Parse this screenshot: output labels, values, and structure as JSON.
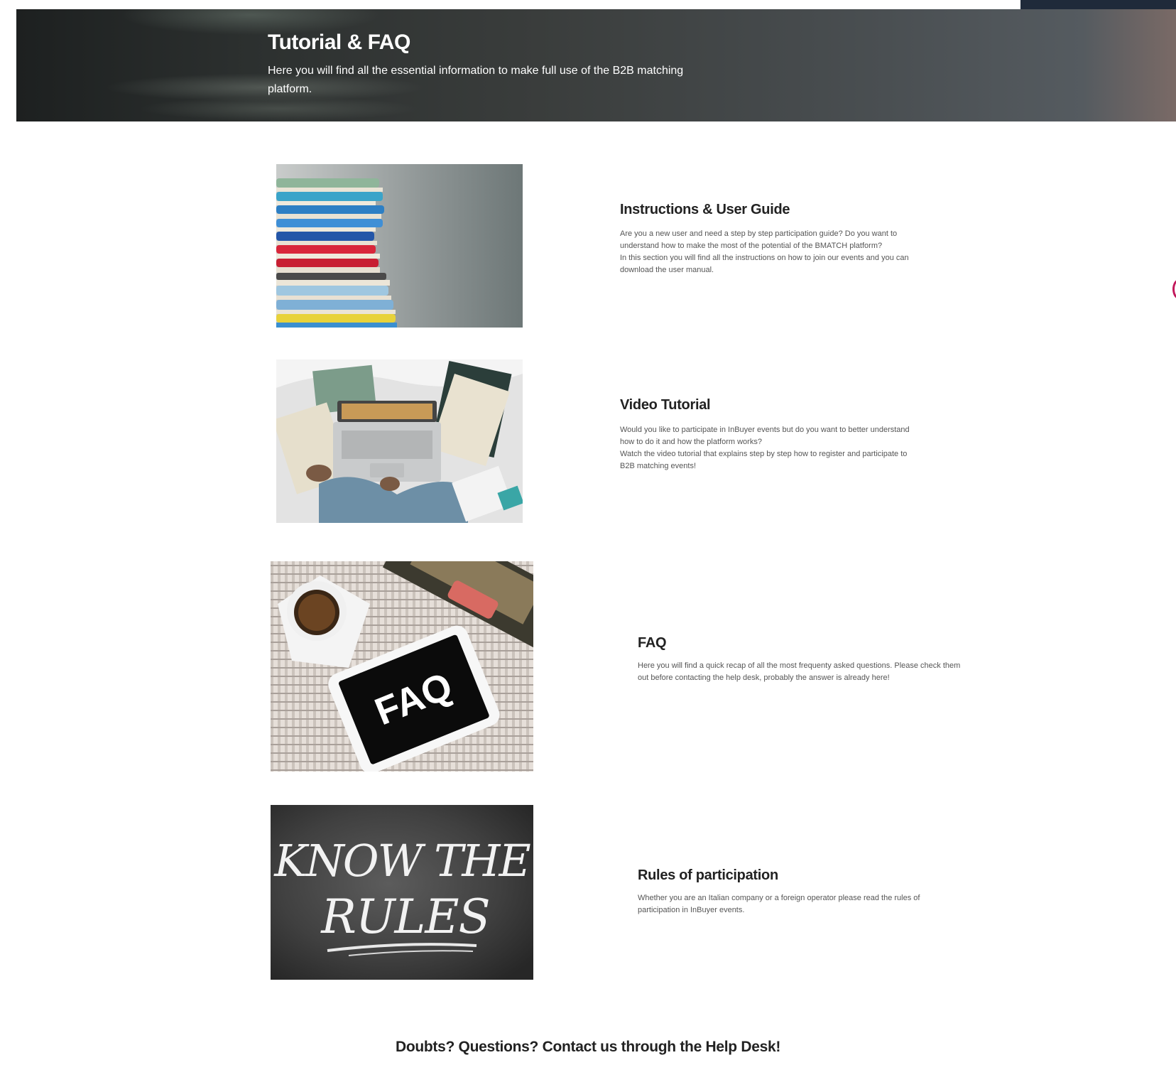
{
  "hero": {
    "title": "Tutorial & FAQ",
    "subtitle": "Here you will find all the essential information to make full use of the B2B matching platform."
  },
  "sections": [
    {
      "title": "Instructions & User Guide",
      "description": "Are you a new user and need a step by step participation guide? Do you want to understand how to make the most of the potential of the BMATCH platform?\nIn this section you will find all the instructions on how to join our events and you can download the user manual.",
      "image": "stacked-books-image"
    },
    {
      "title": "Video Tutorial",
      "description": "Would you like to participate in InBuyer events but do you want to better understand how to do it and how the platform works?\nWatch the video tutorial that explains step by step how to register and participate to B2B matching events!",
      "image": "laptop-on-bed-image"
    },
    {
      "title": "FAQ",
      "description": "Here you will find a quick recap of all the most frequenty asked questions. Please check them out before contacting the help desk, probably the answer is already here!",
      "image": "faq-tablet-image",
      "image_text": "FAQ"
    },
    {
      "title": "Rules of participation",
      "description": "Whether you are an Italian company or a foreign operator please read the rules of participation in InBuyer events.",
      "image": "know-the-rules-chalkboard-image",
      "image_text": "KNOW THE RULES"
    }
  ],
  "footer": {
    "helpdesk_text": "Doubts? Questions? Contact us through the Help Desk!"
  },
  "colors": {
    "hero_dark": "#2c302f",
    "top_right_block": "#1f2a3a",
    "side_accent": "#c2185b"
  }
}
